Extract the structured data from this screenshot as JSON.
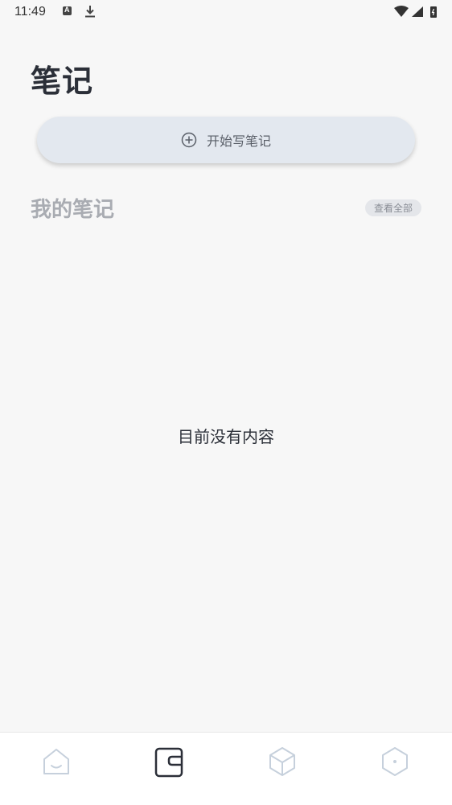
{
  "status_bar": {
    "time": "11:49"
  },
  "page": {
    "title": "笔记"
  },
  "new_note": {
    "label": "开始写笔记"
  },
  "section": {
    "title": "我的笔记",
    "view_all_label": "查看全部"
  },
  "empty_state": {
    "text": "目前没有内容"
  },
  "bottom_nav": {
    "items": [
      {
        "icon": "home-icon",
        "active": false
      },
      {
        "icon": "notes-icon",
        "active": true
      },
      {
        "icon": "box-icon",
        "active": false
      },
      {
        "icon": "profile-icon",
        "active": false
      }
    ]
  },
  "colors": {
    "background": "#f7f7f7",
    "button_bg": "#e3e8ef",
    "title_text": "#2b2f38",
    "muted_text": "#a9acb2",
    "active_icon": "#2b2f38",
    "inactive_icon": "#c6d0dc"
  }
}
